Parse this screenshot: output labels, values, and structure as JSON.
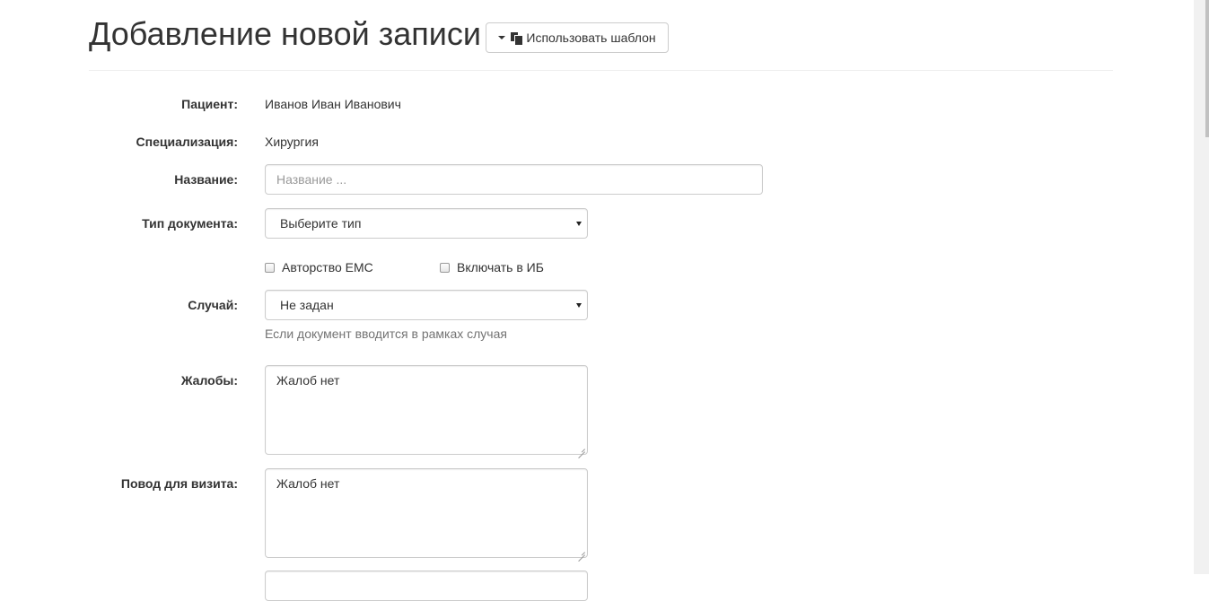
{
  "page": {
    "title": "Добавление новой записи"
  },
  "template_button": {
    "label": "Использовать шаблон"
  },
  "form": {
    "patient": {
      "label": "Пациент:",
      "value": "Иванов Иван Иванович"
    },
    "specialization": {
      "label": "Специализация:",
      "value": "Хирургия"
    },
    "name": {
      "label": "Название:",
      "placeholder": "Название ...",
      "value": ""
    },
    "doc_type": {
      "label": "Тип документа:",
      "selected": "Выберите тип"
    },
    "checkboxes": [
      {
        "label": "Авторство ЕМС",
        "checked": false
      },
      {
        "label": "Включать в ИБ",
        "checked": false
      }
    ],
    "case": {
      "label": "Случай:",
      "selected": "Не задан",
      "help": "Если документ вводится в рамках случая"
    },
    "complaints": {
      "label": "Жалобы:",
      "value": "Жалоб нет"
    },
    "visit_reason": {
      "label": "Повод для визита:",
      "value": "Жалоб нет"
    }
  }
}
